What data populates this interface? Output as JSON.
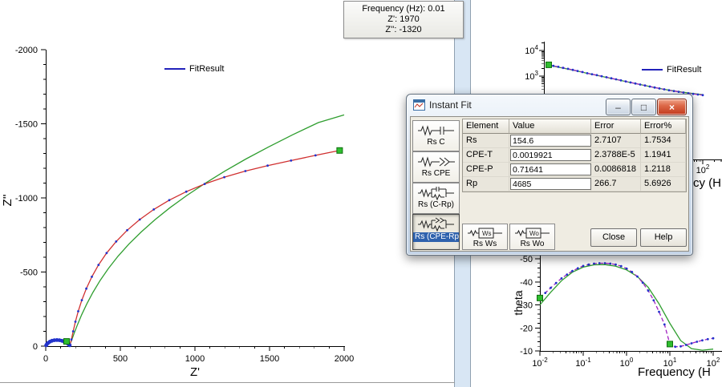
{
  "tooltip": {
    "lines": [
      "Frequency (Hz): 0.01",
      "Z': 1970",
      "Z'': -1320"
    ]
  },
  "dialog": {
    "title": "Instant Fit",
    "caption": {
      "minimize": "–",
      "maximize": "□",
      "close": "×"
    },
    "model_buttons": [
      {
        "label": "Rs C"
      },
      {
        "label": "Rs CPE"
      },
      {
        "label": "Rs (C-Rp)"
      },
      {
        "label": "Rs (CPE-Rp)",
        "selected": true
      },
      {
        "label": "Rs Ws",
        "icon_text": "Ws"
      },
      {
        "label": "Rs Wo",
        "icon_text": "Wo"
      }
    ],
    "table": {
      "headers": [
        "Element",
        "Value",
        "Error",
        "Error%"
      ],
      "rows": [
        {
          "element": "Rs",
          "value": "154.6",
          "error": "2.7107",
          "error_pct": "1.7534"
        },
        {
          "element": "CPE-T",
          "value": "0.0019921",
          "error": "2.3788E-5",
          "error_pct": "1.1941"
        },
        {
          "element": "CPE-P",
          "value": "0.71641",
          "error": "0.0086818",
          "error_pct": "1.2118"
        },
        {
          "element": "Rp",
          "value": "4685",
          "error": "266.7",
          "error_pct": "5.6926"
        }
      ]
    },
    "buttons": {
      "close": "Close",
      "help": "Help"
    }
  },
  "chart_data": [
    {
      "id": "nyquist",
      "type": "line",
      "xlabel": "Z'",
      "ylabel": "Z''",
      "xlim": [
        0,
        2000
      ],
      "ylim": [
        0,
        -2000
      ],
      "xticks": [
        0,
        500,
        1000,
        1500,
        2000
      ],
      "yticks": [
        -2000,
        -1500,
        -1000,
        -500,
        0
      ],
      "legend": [
        {
          "label": "FitResult",
          "color": "#2222bb"
        }
      ],
      "series": [
        {
          "name": "data-highfreq-arc",
          "style": "dots",
          "color": "#2233cc",
          "dot_r": 2.4,
          "points": [
            [
              3,
              -6
            ],
            [
              8,
              -14
            ],
            [
              16,
              -22
            ],
            [
              28,
              -30
            ],
            [
              42,
              -36
            ],
            [
              58,
              -40
            ],
            [
              75,
              -41
            ],
            [
              92,
              -40
            ],
            [
              108,
              -36
            ],
            [
              122,
              -31
            ],
            [
              135,
              -25
            ],
            [
              146,
              -18
            ],
            [
              155,
              -11
            ],
            [
              161,
              -6
            ]
          ]
        },
        {
          "name": "data",
          "style": "line+dots",
          "line_color": "#d03030",
          "dot_color": "#2233cc",
          "points": [
            [
              163,
              -10
            ],
            [
              172,
              -45
            ],
            [
              184,
              -100
            ],
            [
              199,
              -165
            ],
            [
              218,
              -235
            ],
            [
              242,
              -310
            ],
            [
              272,
              -388
            ],
            [
              309,
              -468
            ],
            [
              354,
              -548
            ],
            [
              408,
              -628
            ],
            [
              472,
              -706
            ],
            [
              546,
              -782
            ],
            [
              630,
              -854
            ],
            [
              724,
              -922
            ],
            [
              828,
              -985
            ],
            [
              942,
              -1042
            ],
            [
              1065,
              -1094
            ],
            [
              1197,
              -1140
            ],
            [
              1338,
              -1181
            ],
            [
              1487,
              -1218
            ],
            [
              1644,
              -1252
            ],
            [
              1808,
              -1287
            ],
            [
              1970,
              -1320
            ]
          ]
        },
        {
          "name": "FitResult",
          "style": "line",
          "line_color": "#2f9e2f",
          "points": [
            [
              158,
              -4
            ],
            [
              172,
              -35
            ],
            [
              190,
              -85
            ],
            [
              213,
              -145
            ],
            [
              241,
              -212
            ],
            [
              275,
              -285
            ],
            [
              316,
              -362
            ],
            [
              364,
              -442
            ],
            [
              420,
              -524
            ],
            [
              484,
              -606
            ],
            [
              557,
              -688
            ],
            [
              639,
              -770
            ],
            [
              731,
              -852
            ],
            [
              833,
              -934
            ],
            [
              945,
              -1016
            ],
            [
              1067,
              -1098
            ],
            [
              1199,
              -1180
            ],
            [
              1341,
              -1262
            ],
            [
              1493,
              -1344
            ],
            [
              1655,
              -1426
            ],
            [
              1827,
              -1508
            ],
            [
              2000,
              -1560
            ]
          ]
        },
        {
          "name": "range-markers",
          "style": "squares",
          "color": "#2fbe2f",
          "points": [
            [
              140,
              -32
            ],
            [
              1970,
              -1320
            ]
          ]
        }
      ]
    },
    {
      "id": "bode-magnitude",
      "type": "line",
      "x_scale": "log",
      "y_scale": "log",
      "yticks_visible": [
        {
          "value": 10000,
          "label": "10^4"
        },
        {
          "value": 1000,
          "label": "10^3"
        }
      ],
      "xticks_visible": [
        {
          "value": 100,
          "label": "10^2"
        }
      ],
      "xlabel_visible": "cy (H",
      "legend": [
        {
          "label": "FitResult",
          "color": "#2222bb"
        }
      ],
      "series": [
        {
          "name": "data",
          "style": "dashed+dots",
          "line_color": "#a020c0",
          "dot_color": "#2233cc",
          "points": [
            [
              0.01,
              2750
            ],
            [
              0.0133,
              2520
            ],
            [
              0.0178,
              2300
            ],
            [
              0.0237,
              2100
            ],
            [
              0.0316,
              1920
            ],
            [
              0.0422,
              1750
            ],
            [
              0.0562,
              1590
            ],
            [
              0.075,
              1440
            ],
            [
              0.1,
              1300
            ],
            [
              0.133,
              1190
            ],
            [
              0.178,
              1090
            ],
            [
              0.237,
              995
            ],
            [
              0.316,
              905
            ],
            [
              0.422,
              825
            ],
            [
              0.562,
              750
            ],
            [
              0.75,
              682
            ],
            [
              1,
              620
            ],
            [
              1.33,
              565
            ],
            [
              1.78,
              515
            ],
            [
              2.37,
              470
            ],
            [
              3.16,
              430
            ],
            [
              4.22,
              393
            ],
            [
              5.62,
              360
            ],
            [
              7.5,
              331
            ],
            [
              10,
              305
            ],
            [
              13.3,
              282
            ],
            [
              17.8,
              262
            ],
            [
              23.7,
              244
            ],
            [
              31.6,
              228
            ],
            [
              42.2,
              214
            ],
            [
              56.2,
              202
            ],
            [
              75,
              191
            ],
            [
              100,
              182
            ]
          ]
        },
        {
          "name": "FitResult",
          "style": "line",
          "line_color": "#2f9e2f",
          "points": [
            [
              0.01,
              2650
            ],
            [
              0.0178,
              2230
            ],
            [
              0.0316,
              1870
            ],
            [
              0.0562,
              1560
            ],
            [
              0.1,
              1290
            ],
            [
              0.178,
              1072
            ],
            [
              0.316,
              893
            ],
            [
              0.562,
              742
            ],
            [
              1,
              616
            ],
            [
              1.78,
              512
            ],
            [
              3.16,
              428
            ],
            [
              5.62,
              360
            ],
            [
              10,
              306
            ],
            [
              17.8,
              264
            ],
            [
              31.6,
              232
            ],
            [
              56.2,
              208
            ],
            [
              100,
              190
            ]
          ]
        },
        {
          "name": "range-markers",
          "style": "squares",
          "color": "#2fbe2f",
          "points": [
            [
              0.01,
              2750
            ]
          ]
        }
      ]
    },
    {
      "id": "bode-phase",
      "type": "line",
      "x_scale": "log",
      "ylabel": "theta",
      "xlabel_visible": "Frequency (H",
      "yticks": [
        -50,
        -40,
        -30,
        -20,
        -10
      ],
      "xticks": [
        {
          "value": 0.01,
          "label": "10^-2"
        },
        {
          "value": 0.1,
          "label": "10^-1"
        },
        {
          "value": 1,
          "label": "10^0"
        },
        {
          "value": 10,
          "label": "10^1"
        },
        {
          "value": 100,
          "label": "10^2"
        }
      ],
      "series": [
        {
          "name": "data",
          "style": "dashed+dots",
          "line_color": "#a020c0",
          "dot_color": "#2233cc",
          "points": [
            [
              0.01,
              -33
            ],
            [
              0.0133,
              -35.2
            ],
            [
              0.0178,
              -37.4
            ],
            [
              0.0237,
              -39.5
            ],
            [
              0.0316,
              -41.5
            ],
            [
              0.0422,
              -43.2
            ],
            [
              0.0562,
              -44.7
            ],
            [
              0.075,
              -45.9
            ],
            [
              0.1,
              -46.9
            ],
            [
              0.133,
              -47.5
            ],
            [
              0.178,
              -47.9
            ],
            [
              0.237,
              -48.1
            ],
            [
              0.316,
              -48.1
            ],
            [
              0.422,
              -47.9
            ],
            [
              0.562,
              -47.5
            ],
            [
              0.75,
              -46.8
            ],
            [
              1,
              -45.8
            ],
            [
              1.33,
              -44.3
            ],
            [
              1.78,
              -42.3
            ],
            [
              2.37,
              -39.6
            ],
            [
              3.16,
              -36.2
            ],
            [
              4.22,
              -32
            ],
            [
              5.62,
              -27
            ],
            [
              7.5,
              -21.5
            ],
            [
              10,
              -13
            ],
            [
              13.3,
              -11.8
            ],
            [
              17.8,
              -12
            ],
            [
              23.7,
              -12.6
            ],
            [
              31.6,
              -13.3
            ],
            [
              42.2,
              -14
            ],
            [
              56.2,
              -14.6
            ],
            [
              75,
              -15.1
            ],
            [
              100,
              -15.5
            ]
          ]
        },
        {
          "name": "FitResult",
          "style": "line",
          "line_color": "#2f9e2f",
          "points": [
            [
              0.01,
              -30
            ],
            [
              0.0178,
              -35.5
            ],
            [
              0.0316,
              -40.5
            ],
            [
              0.0562,
              -44.2
            ],
            [
              0.1,
              -46.4
            ],
            [
              0.178,
              -47.4
            ],
            [
              0.316,
              -47.5
            ],
            [
              0.562,
              -46.8
            ],
            [
              1,
              -45.2
            ],
            [
              1.78,
              -42.3
            ],
            [
              3.16,
              -37.6
            ],
            [
              5.62,
              -30.5
            ],
            [
              10,
              -22
            ],
            [
              17.8,
              -14.5
            ],
            [
              31.6,
              -11
            ],
            [
              56.2,
              -10.3
            ],
            [
              100,
              -10.8
            ]
          ]
        },
        {
          "name": "range-markers",
          "style": "squares",
          "color": "#2fbe2f",
          "points": [
            [
              0.01,
              -33
            ],
            [
              10,
              -13
            ]
          ]
        }
      ]
    }
  ]
}
